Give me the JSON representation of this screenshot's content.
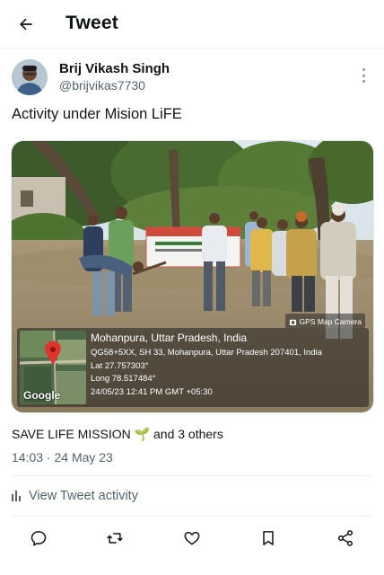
{
  "header": {
    "title": "Tweet",
    "back_icon": "arrow-left-icon"
  },
  "author": {
    "name": "Brij Vikash Singh",
    "handle": "@brijvikas7730",
    "more_icon": "more-vertical-icon"
  },
  "tweet": {
    "text": "Activity under Mision LiFE"
  },
  "media": {
    "badge": "GPS Map Camera",
    "map_label": "Google",
    "location": "Mohanpura, Uttar Pradesh, India",
    "address": "QG58+5XX, SH 33, Mohanpura, Uttar Pradesh 207401, India",
    "lat": "Lat 27.757303°",
    "long": "Long 78.517484°",
    "datetime": "24/05/23 12:41 PM GMT +05:30"
  },
  "stats": {
    "liked_by": "SAVE LIFE MISSION",
    "emoji": "🌱",
    "others": "and 3 others"
  },
  "timestamp": "14:03 · 24 May 23",
  "activity": {
    "label": "View Tweet activity",
    "icon": "bar-chart-icon"
  },
  "actions": [
    {
      "name": "reply",
      "icon": "reply-icon"
    },
    {
      "name": "retweet",
      "icon": "retweet-icon"
    },
    {
      "name": "like",
      "icon": "heart-icon"
    },
    {
      "name": "bookmark",
      "icon": "bookmark-icon"
    },
    {
      "name": "share",
      "icon": "share-icon"
    }
  ],
  "colors": {
    "text": "#0f1419",
    "secondary": "#536471",
    "border": "#eff3f4"
  }
}
